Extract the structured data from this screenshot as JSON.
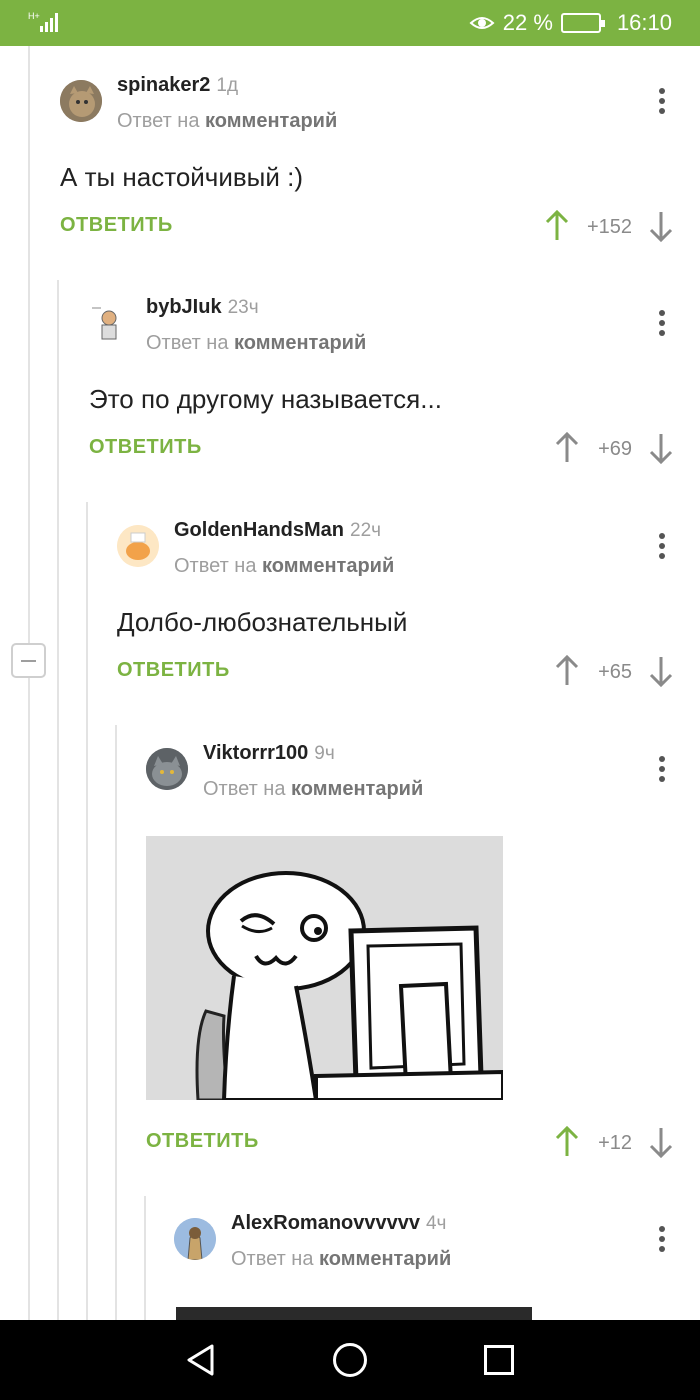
{
  "status_bar": {
    "battery_percent": "22 %",
    "time": "16:10",
    "network": "H+"
  },
  "reply_to_prefix": "Ответ на",
  "reply_to_link": "комментарий",
  "comments": [
    {
      "author": "spinaker2",
      "time": "1д",
      "text": "А ты настойчивый :)",
      "reply_label": "ОТВЕТИТЬ",
      "rating": "+152",
      "vote": "up"
    },
    {
      "author": "bybJIuk",
      "time": "23ч",
      "text": "Это по другому называется...",
      "reply_label": "ОТВЕТИТЬ",
      "rating": "+69",
      "vote": "none"
    },
    {
      "author": "GoldenHandsMan",
      "time": "22ч",
      "text": "Долбо-любознательный",
      "reply_label": "ОТВЕТИТЬ",
      "rating": "+65",
      "vote": "none"
    },
    {
      "author": "Viktorrr100",
      "time": "9ч",
      "text": "",
      "reply_label": "ОТВЕТИТЬ",
      "rating": "+12",
      "vote": "up",
      "image": "meme-face-computer"
    },
    {
      "author": "AlexRomanovvvvvv",
      "time": "4ч",
      "text": "",
      "reply_label": "",
      "rating": "",
      "vote": "none"
    }
  ],
  "colors": {
    "accent": "#7cb342",
    "muted": "#9e9e9e"
  },
  "icons": [
    "signal-icon",
    "eye-icon",
    "battery-icon",
    "more-vert-icon",
    "arrow-up-icon",
    "arrow-down-icon",
    "minus-icon",
    "nav-back-icon",
    "nav-home-icon",
    "nav-recents-icon"
  ]
}
